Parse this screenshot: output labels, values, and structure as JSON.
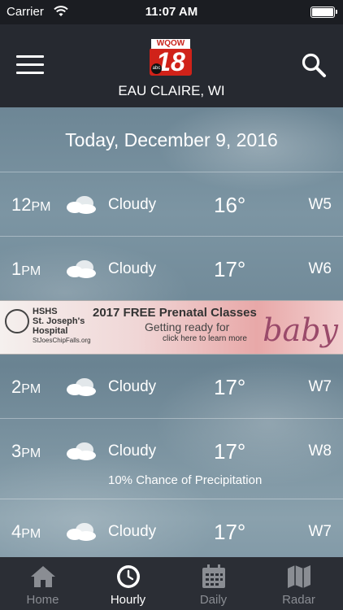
{
  "status_bar": {
    "carrier": "Carrier",
    "time": "11:07 AM"
  },
  "header": {
    "logo_top": "WQOW",
    "logo_number": "18",
    "logo_network": "abc",
    "location": "EAU CLAIRE, WI"
  },
  "date": "Today, December 9, 2016",
  "hours": [
    {
      "hour": "12",
      "ampm": "PM",
      "condition": "Cloudy",
      "temp": "16°",
      "wind": "W5",
      "precip": ""
    },
    {
      "hour": "1",
      "ampm": "PM",
      "condition": "Cloudy",
      "temp": "17°",
      "wind": "W6",
      "precip": ""
    },
    {
      "hour": "2",
      "ampm": "PM",
      "condition": "Cloudy",
      "temp": "17°",
      "wind": "W7",
      "precip": ""
    },
    {
      "hour": "3",
      "ampm": "PM",
      "condition": "Cloudy",
      "temp": "17°",
      "wind": "W8",
      "precip": "10% Chance of Precipitation"
    },
    {
      "hour": "4",
      "ampm": "PM",
      "condition": "Cloudy",
      "temp": "17°",
      "wind": "W7",
      "precip": ""
    }
  ],
  "ad": {
    "hospital_line1": "HSHS",
    "hospital_line2": "St. Joseph's",
    "hospital_line3": "Hospital",
    "url": "StJoesChipFalls.org",
    "headline": "2017 FREE Prenatal Classes",
    "sub1": "Getting ready for",
    "sub2": "click here to learn more",
    "script": "baby"
  },
  "tabs": [
    {
      "label": "Home",
      "icon": "home-icon",
      "active": false
    },
    {
      "label": "Hourly",
      "icon": "clock-icon",
      "active": true
    },
    {
      "label": "Daily",
      "icon": "calendar-icon",
      "active": false
    },
    {
      "label": "Radar",
      "icon": "map-icon",
      "active": false
    }
  ],
  "colors": {
    "header_bg": "#262930",
    "tab_bar_bg": "#2b2e35",
    "logo_red": "#d02219",
    "inactive_tab": "#8a8d93"
  }
}
